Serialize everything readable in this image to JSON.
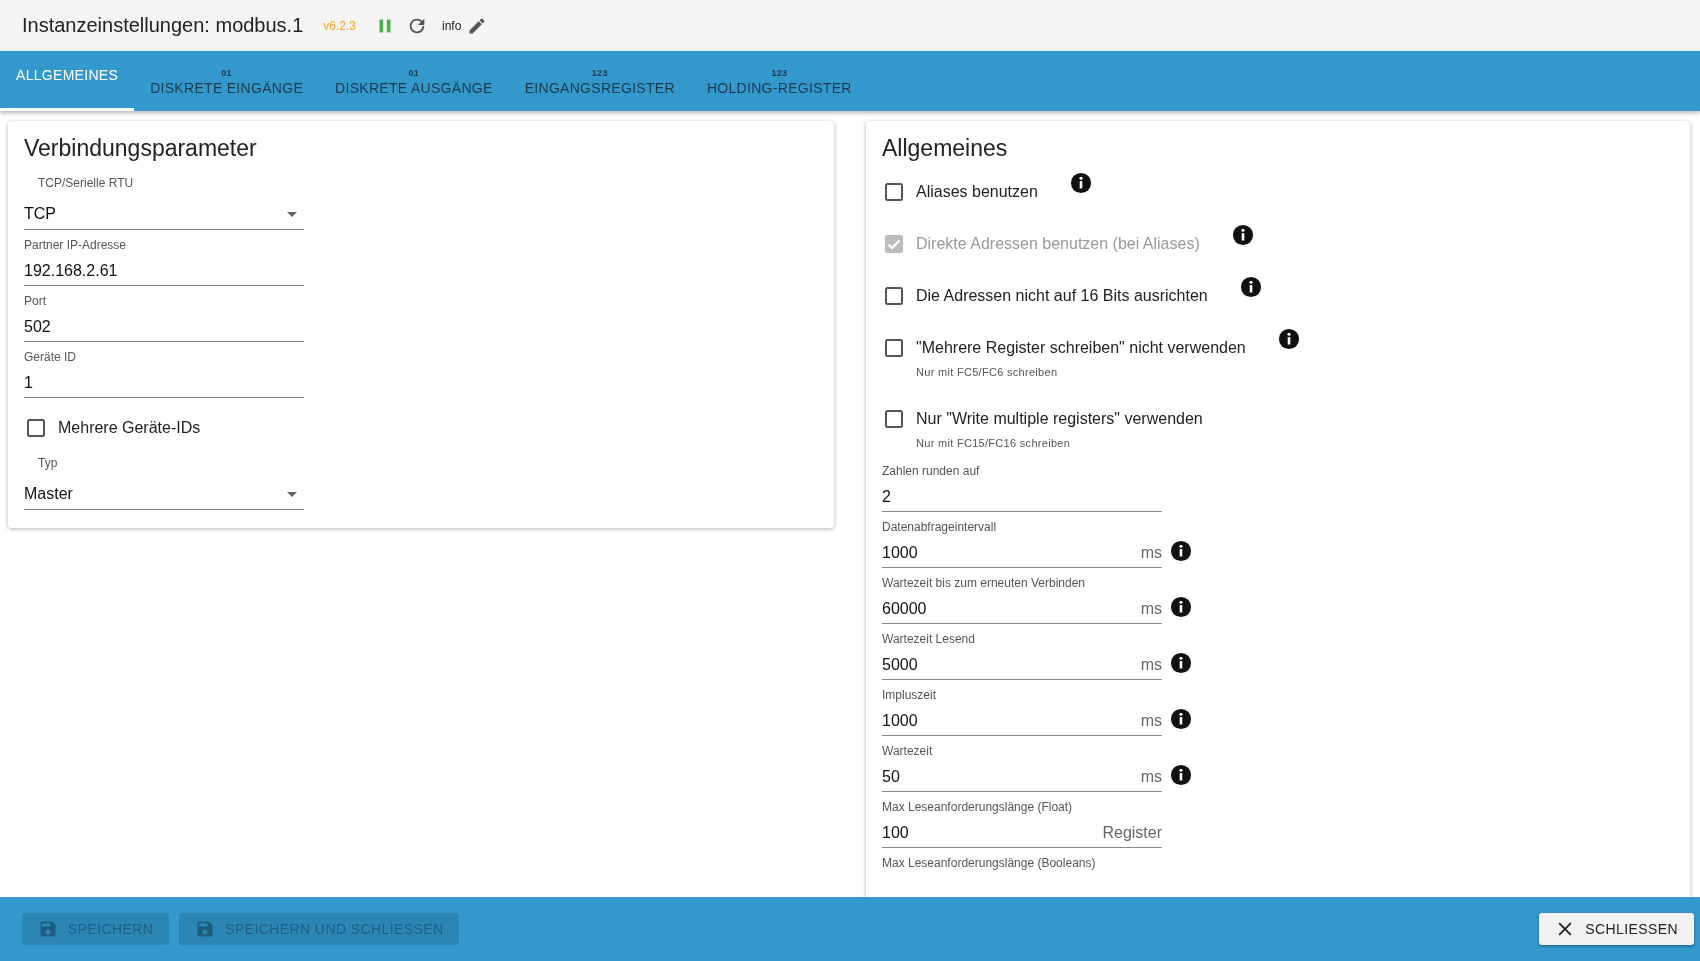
{
  "window": {
    "title": "Instanzeinstellungen: modbus.1",
    "version": "v6.2.3",
    "running": true,
    "info_label": "info"
  },
  "tabs": [
    {
      "label": "ALLGEMEINES",
      "selected": true
    },
    {
      "label": "DISKRETE EINGÄNGE",
      "badge": "01",
      "selected": false
    },
    {
      "label": "DISKRETE AUSGÄNGE",
      "badge": "01",
      "selected": false
    },
    {
      "label": "EINGANGSREGISTER",
      "badge": "123",
      "selected": false
    },
    {
      "label": "HOLDING-REGISTER",
      "badge": "123",
      "selected": false
    }
  ],
  "connection_panel": {
    "title": "Verbindungsparameter",
    "fields": [
      {
        "kind": "select",
        "label": "TCP/Serielle RTU",
        "value": "TCP"
      },
      {
        "kind": "text",
        "label": "Partner IP-Adresse",
        "value": "192.168.2.61"
      },
      {
        "kind": "text",
        "label": "Port",
        "value": "502"
      },
      {
        "kind": "text",
        "label": "Geräte ID",
        "value": "1"
      },
      {
        "kind": "checkbox",
        "label": "Mehrere Geräte-IDs",
        "checked": false
      },
      {
        "kind": "select",
        "label": "Typ",
        "value": "Master"
      }
    ]
  },
  "general_panel": {
    "title": "Allgemeines",
    "options": [
      {
        "label": "Aliases benutzen",
        "checked": false,
        "disabled": false,
        "info": true
      },
      {
        "label": "Direkte Adressen benutzen (bei Aliases)",
        "checked": true,
        "disabled": true,
        "info": true
      },
      {
        "label": "Die Adressen nicht auf 16 Bits ausrichten",
        "checked": false,
        "disabled": false,
        "info": true
      },
      {
        "label": "\"Mehrere Register schreiben\" nicht verwenden",
        "hint": "Nur mit FC5/FC6 schreiben",
        "checked": false,
        "disabled": false,
        "info": true
      },
      {
        "label": "Nur \"Write multiple registers\" verwenden",
        "hint": "Nur mit FC15/FC16 schreiben",
        "checked": false,
        "disabled": false,
        "info": false
      }
    ],
    "fields": [
      {
        "label": "Zahlen runden auf",
        "value": "2",
        "info": false
      },
      {
        "label": "Datenabfrageintervall",
        "value": "1000",
        "unit": "ms",
        "info": true
      },
      {
        "label": "Wartezeit bis zum erneuten Verbinden",
        "value": "60000",
        "unit": "ms",
        "info": true
      },
      {
        "label": "Wartezeit Lesend",
        "value": "5000",
        "unit": "ms",
        "info": true
      },
      {
        "label": "Impluszeit",
        "value": "1000",
        "unit": "ms",
        "info": true
      },
      {
        "label": "Wartezeit",
        "value": "50",
        "unit": "ms",
        "info": true
      },
      {
        "label": "Max Leseanforderungslänge (Float)",
        "value": "100",
        "unit": "Register",
        "info": false
      },
      {
        "label": "Max Leseanforderungslänge (Booleans)",
        "info": false
      }
    ]
  },
  "footer": {
    "buttons": [
      {
        "kind": "save",
        "label": "SPEICHERN",
        "disabled": true
      },
      {
        "kind": "save",
        "label": "SPEICHERN UND SCHLIESSEN",
        "disabled": true
      },
      {
        "kind": "close",
        "label": "SCHLIESSEN",
        "disabled": false
      }
    ]
  }
}
